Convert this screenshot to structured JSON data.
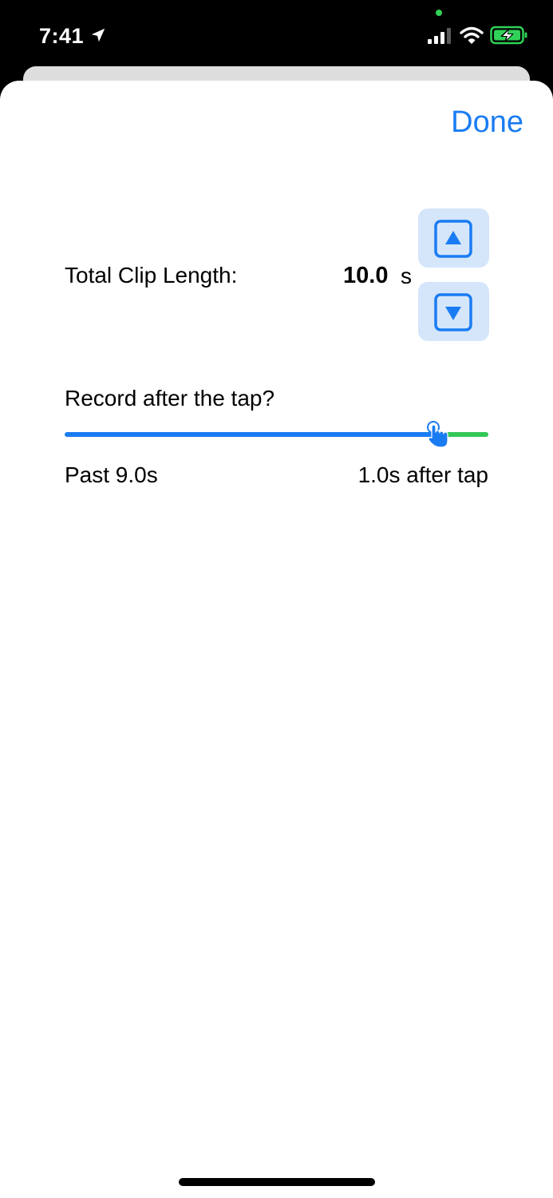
{
  "status_bar": {
    "time": "7:41",
    "icons": [
      "location-arrow-icon",
      "mic-indicator-dot",
      "cellular-signal-icon",
      "wifi-icon",
      "battery-charging-icon"
    ],
    "indicator_color": "#30d158",
    "battery_color": "#30d158"
  },
  "sheet": {
    "done_label": "Done",
    "accent_color": "#1a7cf2"
  },
  "clip_length": {
    "label": "Total Clip Length:",
    "value": "10.0",
    "unit": "s",
    "increment_icon": "triangle-up-icon",
    "decrement_icon": "triangle-down-icon"
  },
  "record_after": {
    "label": "Record after the tap?",
    "slider_fraction": 0.875,
    "min_track_color": "#1a7cf2",
    "max_track_color": "#34c759",
    "left_label": "Past 9.0s",
    "right_label": "1.0s after tap"
  }
}
